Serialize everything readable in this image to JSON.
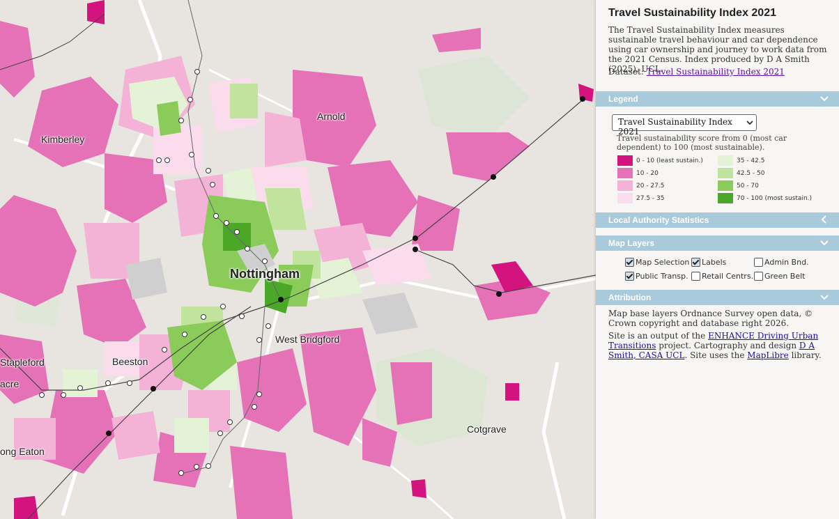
{
  "panel": {
    "title": "Travel Sustainability Index 2021",
    "description": "The Travel Sustainability Index measures sustainable travel behaviour and car dependence using car ownership and journey to work data from the 2021 Census. Index produced by D A Smith (2025), UCL.",
    "dataset_label": "Dataset:",
    "dataset_link": "Travel Sustainability Index 2021"
  },
  "legend": {
    "header": "Legend",
    "select_value": "Travel Sustainability Index 2021",
    "description": "Travel sustainability score from 0 (most car dependent) to 100 (most sustainable).",
    "items": [
      {
        "label": "0 - 10 (least sustain.)",
        "color": "#d4147e"
      },
      {
        "label": "10 - 20",
        "color": "#e571b6"
      },
      {
        "label": "20 - 27.5",
        "color": "#f3b2d6"
      },
      {
        "label": "27.5 - 35",
        "color": "#fadcec"
      },
      {
        "label": "35 - 42.5",
        "color": "#e4f2d6"
      },
      {
        "label": "42.5 - 50",
        "color": "#c0e39e"
      },
      {
        "label": "50 - 70",
        "color": "#8bcb5a"
      },
      {
        "label": "70 - 100 (most sustain.)",
        "color": "#4aa727"
      }
    ]
  },
  "la_stats": {
    "header": "Local Authority Statistics"
  },
  "layers": {
    "header": "Map Layers",
    "options": [
      {
        "label": "Map Selection",
        "checked": true
      },
      {
        "label": "Labels",
        "checked": true
      },
      {
        "label": "Admin Bnd.",
        "checked": false
      },
      {
        "label": "Public Transp.",
        "checked": true
      },
      {
        "label": "Retail Centrs.",
        "checked": false
      },
      {
        "label": "Green Belt",
        "checked": false
      }
    ]
  },
  "attribution": {
    "header": "Attribution",
    "line1": "Map base layers Ordnance Survey open data, © Crown copyright and database right 2026.",
    "p2_a": "Site is an output of the ",
    "p2_link1": "ENHANCE Driving Urban Transitions",
    "p2_b": " project. Cartography and design ",
    "p2_link2": "D A Smith, CASA UCL",
    "p2_c": ". Site uses the ",
    "p2_link3": "MapLibre",
    "p2_d": " library."
  },
  "map": {
    "places": [
      "Arnold",
      "Kimberley",
      "Nottingham",
      "West Bridgford",
      "Stapleford",
      "Beeston",
      "acre",
      "ong Eaton",
      "Cotgrave"
    ]
  }
}
